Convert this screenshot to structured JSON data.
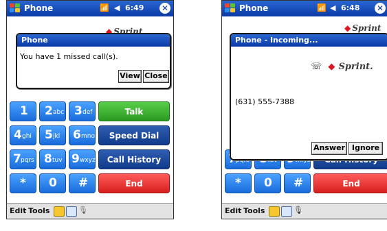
{
  "left_screen": {
    "title": "Phone",
    "time": "6:49",
    "notification": {
      "header": "Phone",
      "message": "You have 1 missed call(s).",
      "view_label": "View",
      "close_label": "Close"
    },
    "keypad": {
      "row1": [
        "1",
        "2",
        "abc",
        "3",
        "def",
        "Talk"
      ],
      "row2": [
        "4",
        "ghi",
        "5",
        "jkl",
        "6",
        "mno",
        "Speed Dial"
      ],
      "row3": [
        "7",
        "pqrs",
        "8",
        "tuv",
        "9",
        "wxyz",
        "Call History"
      ],
      "row4": [
        "*",
        "0",
        "#",
        "End"
      ]
    },
    "menu": {
      "edit": "Edit",
      "tools": "Tools"
    }
  },
  "right_screen": {
    "title": "Phone",
    "time": "6:48",
    "incoming": {
      "header": "Phone - Incoming...",
      "brand": "Sprint.",
      "number": "(631) 555-7388",
      "answer_label": "Answer",
      "ignore_label": "Ignore"
    },
    "keypad": {
      "row3": [
        "7",
        "pqrs",
        "8",
        "tuv",
        "9",
        "wxyz",
        "Call History"
      ],
      "row4": [
        "*",
        "0",
        "#",
        "End"
      ]
    },
    "menu": {
      "edit": "Edit",
      "tools": "Tools"
    }
  }
}
